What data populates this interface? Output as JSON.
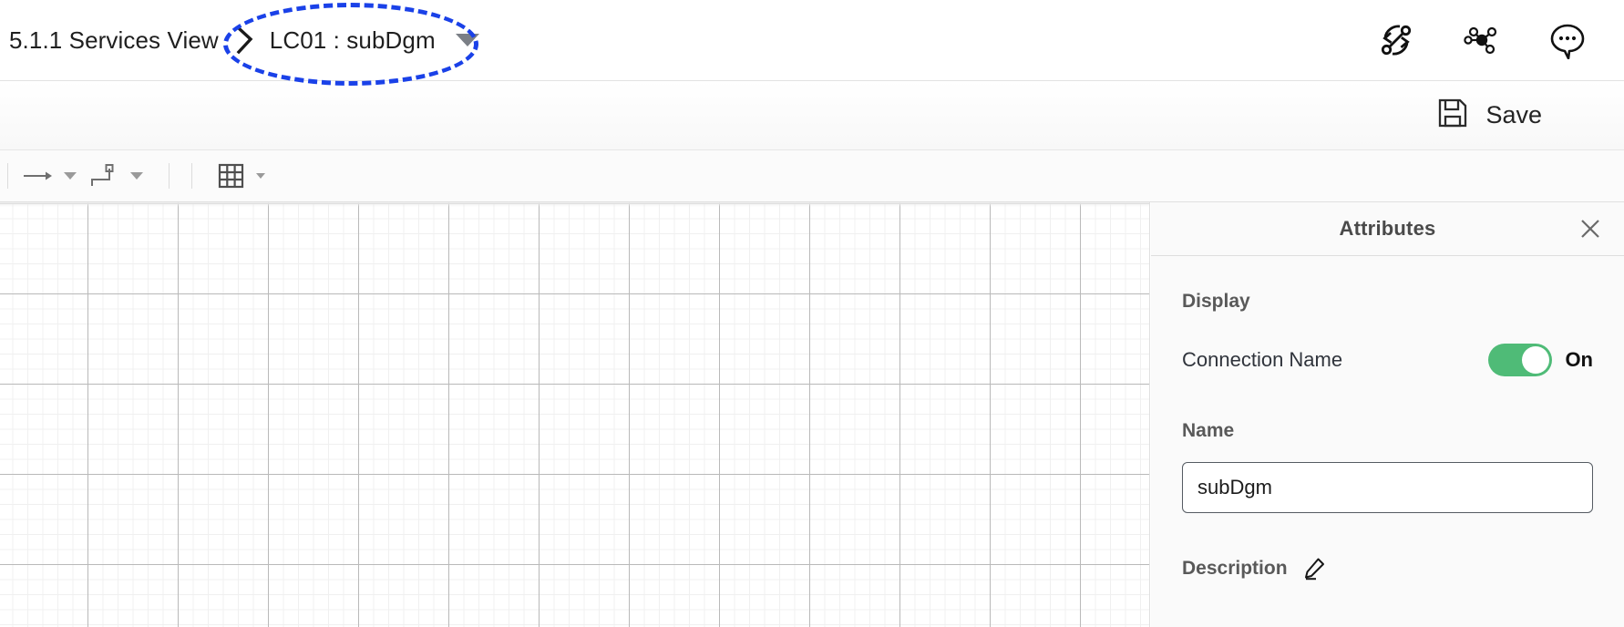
{
  "breadcrumb": {
    "root_label": "5.1.1 Services View",
    "separator_icon": "branch-chevron-icon",
    "current_label": "LC01 : subDgm",
    "caret_icon": "chevron-down-icon"
  },
  "annotation": {
    "shape": "ellipse",
    "color": "#1a41e8",
    "style": "dashed"
  },
  "topbar_actions": [
    {
      "name": "relationships-icon",
      "icon": "connection-swap-icon"
    },
    {
      "name": "network-hub-icon",
      "icon": "molecule-node-icon"
    },
    {
      "name": "comments-icon",
      "icon": "chat-bubble-dots-icon"
    }
  ],
  "savebar": {
    "save_label": "Save",
    "save_icon": "floppy-disk-icon"
  },
  "toolbar": {
    "items": [
      {
        "name": "straight-connector-tool",
        "icon": "straight-arrow-icon",
        "has_dropdown": true
      },
      {
        "name": "orthogonal-connector-tool",
        "icon": "elbow-connector-icon",
        "has_dropdown": true
      },
      {
        "name": "grid-tool",
        "icon": "grid-table-icon",
        "has_dropdown": true
      }
    ]
  },
  "attributes_panel": {
    "title": "Attributes",
    "close_icon": "close-icon",
    "display_section": {
      "title": "Display",
      "connection_name": {
        "label": "Connection Name",
        "state": "On",
        "enabled": true,
        "accent_color": "#4fbb77"
      }
    },
    "name_field": {
      "label": "Name",
      "value": "subDgm",
      "placeholder": "Name"
    },
    "description_field": {
      "label": "Description",
      "edit_icon": "pencil-icon"
    }
  }
}
